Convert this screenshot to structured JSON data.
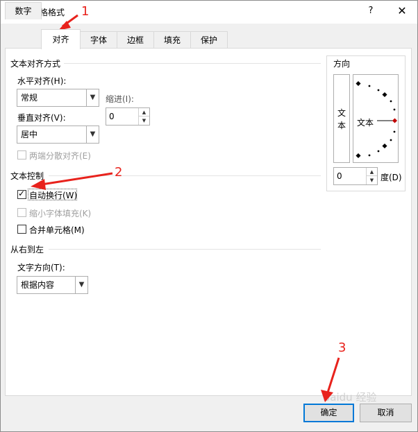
{
  "window": {
    "title": "设置单元格格式",
    "help_icon": "?",
    "close_icon": "✕"
  },
  "tabs": [
    "数字",
    "对齐",
    "字体",
    "边框",
    "填充",
    "保护"
  ],
  "active_tab": "对齐",
  "text_alignment": {
    "group_title": "文本对齐方式",
    "horizontal_label": "水平对齐(H):",
    "horizontal_value": "常规",
    "indent_label": "缩进(I):",
    "indent_value": "0",
    "vertical_label": "垂直对齐(V):",
    "vertical_value": "居中",
    "distributed_label": "两端分散对齐(E)"
  },
  "text_control": {
    "group_title": "文本控制",
    "wrap_text_label": "自动换行(W)",
    "wrap_text_checked": true,
    "shrink_label": "缩小字体填充(K)",
    "merge_label": "合并单元格(M)"
  },
  "rtl": {
    "group_title": "从右到左",
    "direction_label": "文字方向(T):",
    "direction_value": "根据内容"
  },
  "orientation": {
    "group_title": "方向",
    "vertical_text": [
      "文",
      "本"
    ],
    "dial_text": "文本",
    "degrees_value": "0",
    "degrees_label": "度(D)"
  },
  "buttons": {
    "ok": "确定",
    "cancel": "取消"
  },
  "annotations": [
    "1",
    "2",
    "3"
  ],
  "watermark": "Baidu 经验",
  "colors": {
    "accent": "#0078d7",
    "annotation": "#e8221c"
  }
}
